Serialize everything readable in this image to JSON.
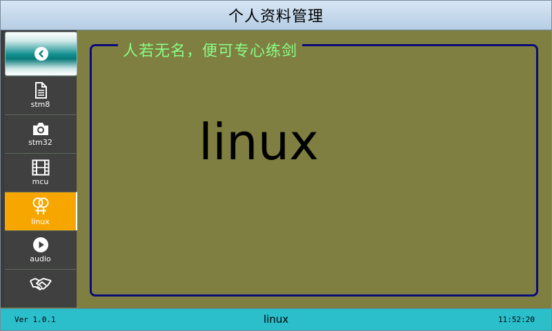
{
  "window": {
    "title": "个人资料管理"
  },
  "sidebar": {
    "back_icon": "chevron-left-circle-icon",
    "items": [
      {
        "label": "stm8",
        "icon": "document-icon",
        "active": false
      },
      {
        "label": "stm32",
        "icon": "camera-icon",
        "active": false
      },
      {
        "label": "mcu",
        "icon": "film-icon",
        "active": false
      },
      {
        "label": "linux",
        "icon": "gender-couple-icon",
        "active": true
      },
      {
        "label": "audio",
        "icon": "play-circle-icon",
        "active": false
      },
      {
        "label": "",
        "icon": "handshake-icon",
        "active": false
      }
    ]
  },
  "main": {
    "frame_title": "人若无名，便可专心练剑",
    "content_text": "linux"
  },
  "status": {
    "version": "Ver 1.0.1",
    "current": "linux",
    "time": "11:52:20"
  },
  "colors": {
    "background": "#7f7f41",
    "accent_active": "#f7a600",
    "statusbar": "#2bbecb",
    "frame_border": "#0a0a7a",
    "legend_text": "#88ff88"
  }
}
